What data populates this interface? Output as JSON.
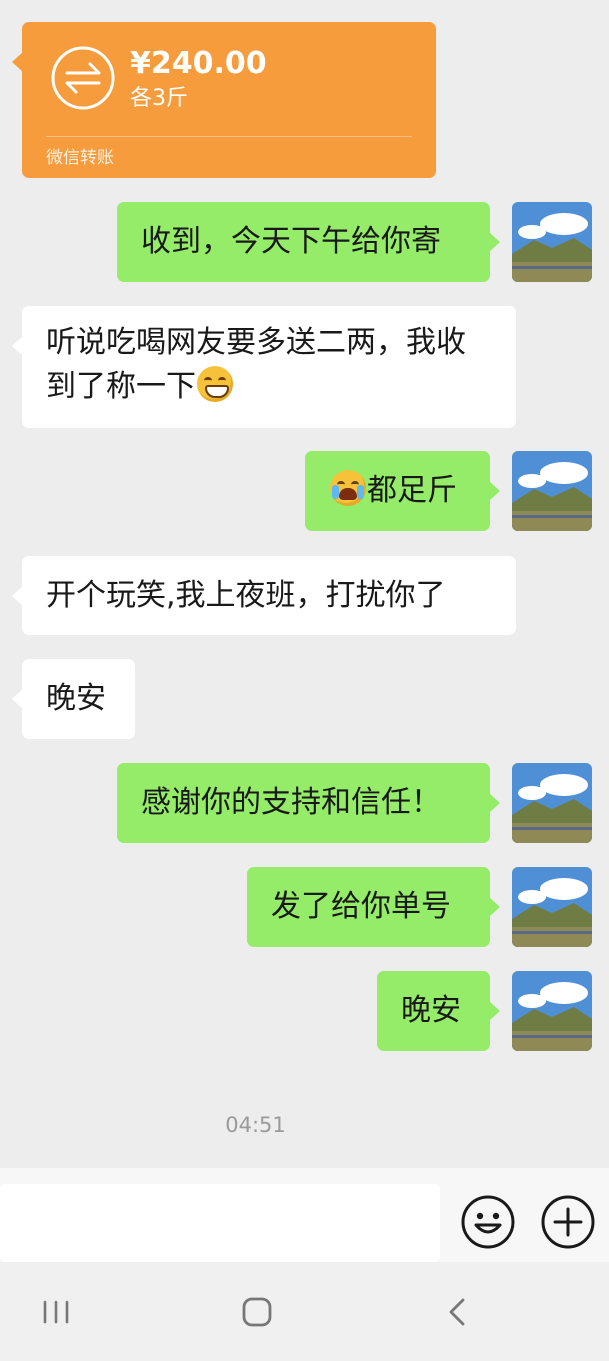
{
  "transfer": {
    "amount": "¥240.00",
    "note": "各3斤",
    "source": "微信转账"
  },
  "messages": [
    {
      "from": "me",
      "text": "收到，今天下午给你寄"
    },
    {
      "from": "other",
      "line1": "听说吃喝网友要多送二两，我收",
      "line2": "到了称一下",
      "emoji": "grin-emoji"
    },
    {
      "from": "me",
      "emoji": "crying-laughing-emoji",
      "text": "都足斤"
    },
    {
      "from": "other",
      "text": "开个玩笑,我上夜班，打扰你了"
    },
    {
      "from": "other",
      "text": "晚安"
    },
    {
      "from": "me",
      "text": "感谢你的支持和信任！"
    },
    {
      "from": "me",
      "text": "发了给你单号"
    },
    {
      "from": "me",
      "text": "晚安"
    }
  ],
  "timestamp": "04:51",
  "input": {
    "value": ""
  },
  "colors": {
    "sent_bubble": "#95ec69",
    "received_bubble": "#ffffff",
    "transfer_card": "#f79c3c",
    "chat_background": "#ededed"
  },
  "icons": {
    "transfer": "transfer-arrows-icon",
    "emoji": "smiley-icon",
    "more": "plus-circle-icon",
    "recents": "recents-icon",
    "home": "home-icon",
    "back": "back-icon"
  }
}
